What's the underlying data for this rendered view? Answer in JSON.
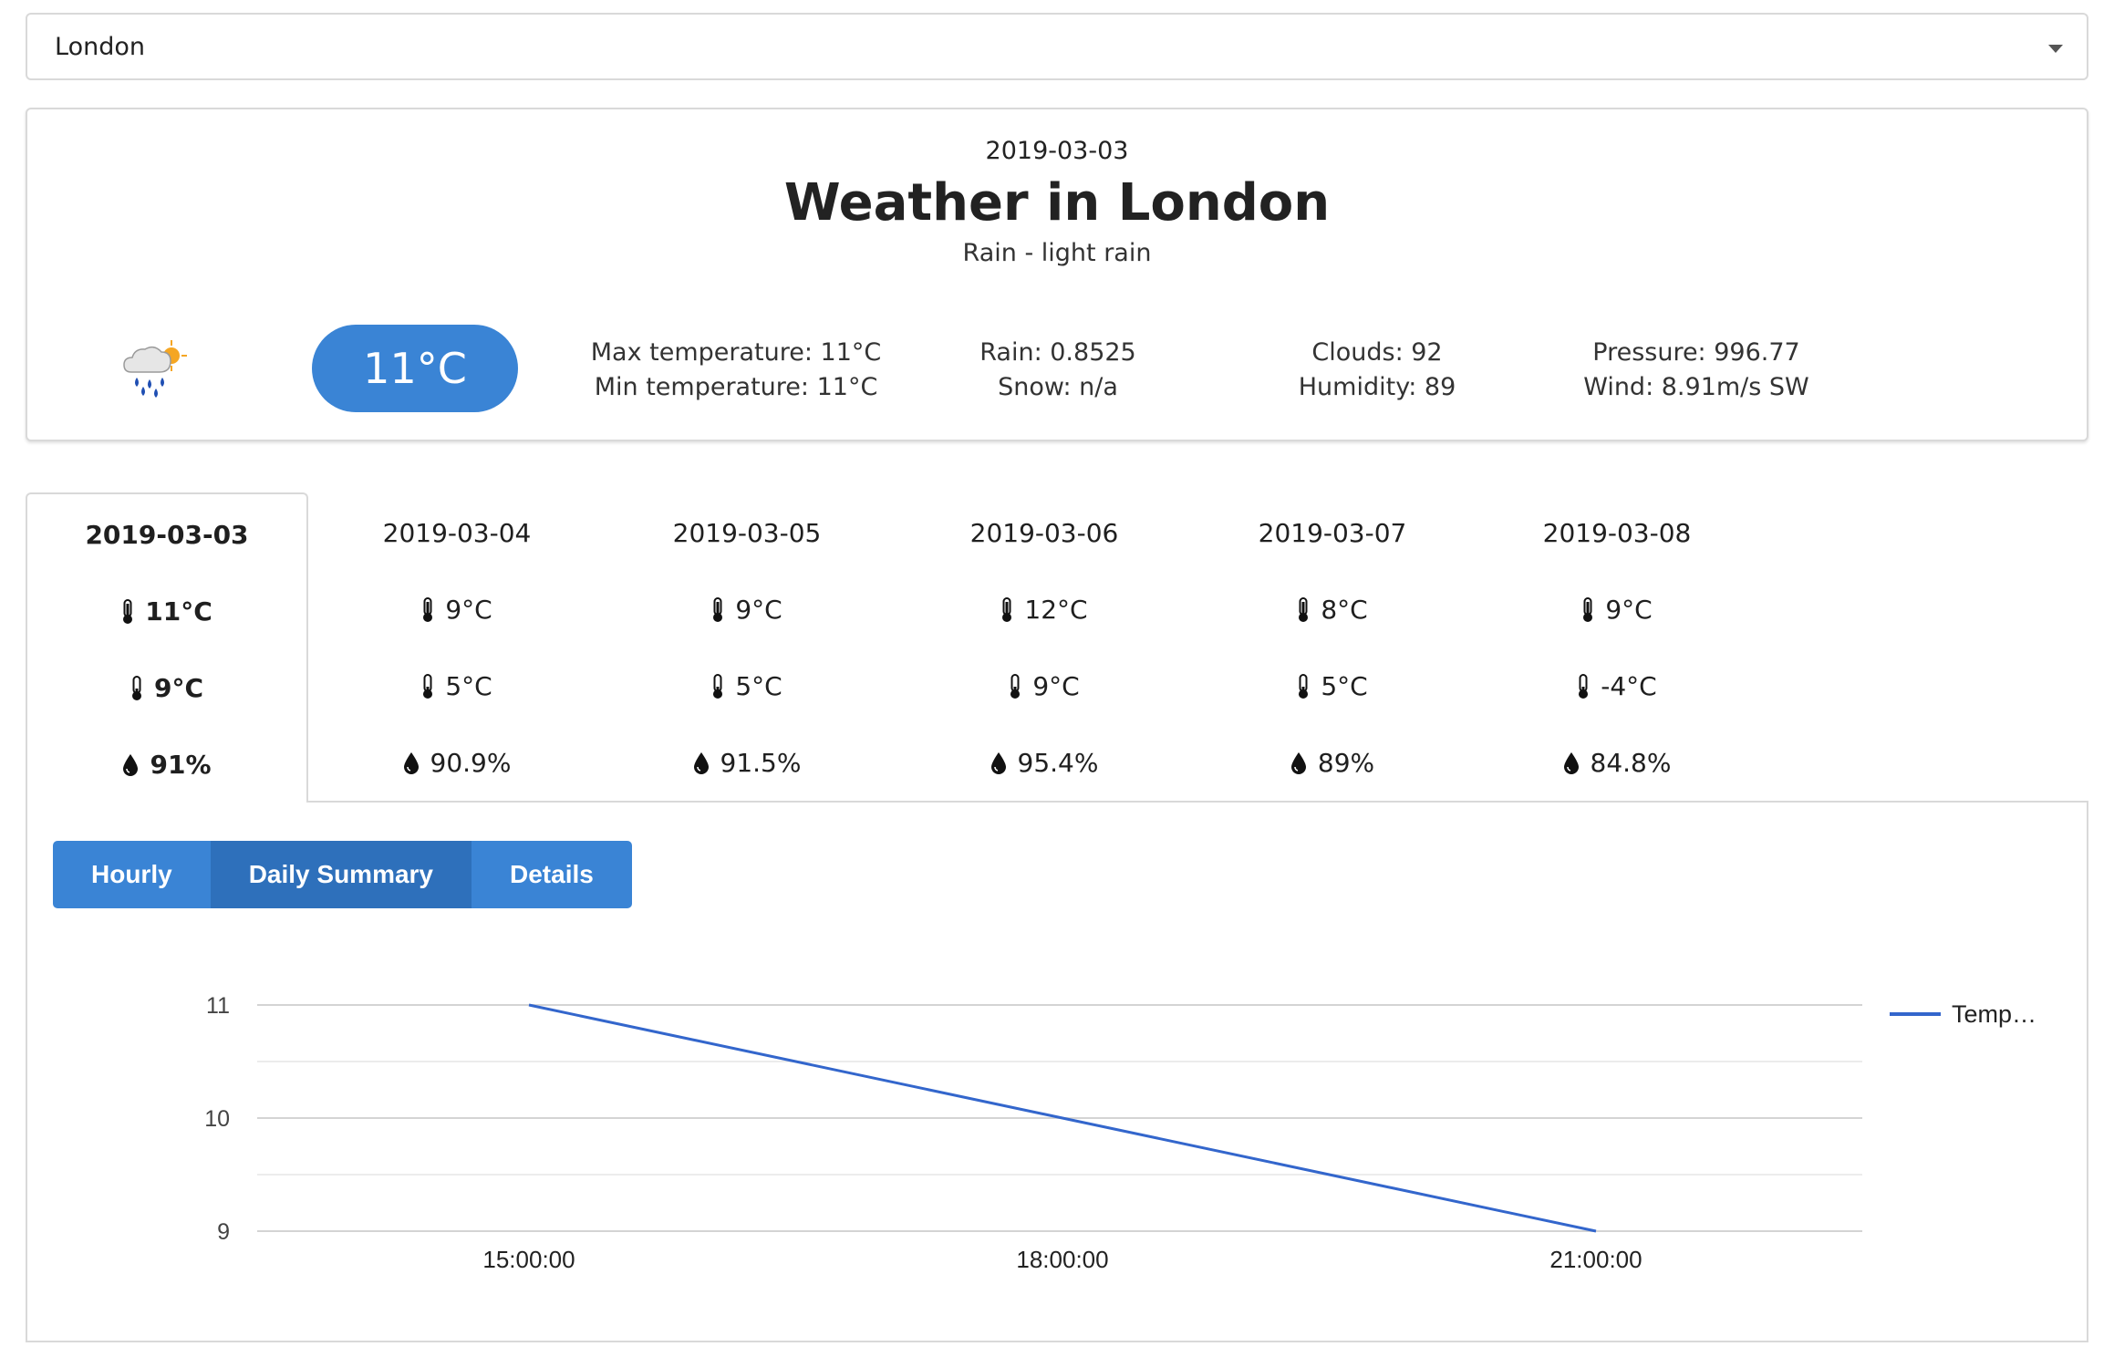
{
  "city_select": {
    "value": "London"
  },
  "summary": {
    "date": "2019-03-03",
    "title": "Weather in London",
    "description": "Rain - light rain",
    "temperature": "11°C",
    "max_temp": "Max temperature: 11°C",
    "min_temp": "Min temperature: 11°C",
    "rain": "Rain: 0.8525",
    "snow": "Snow: n/a",
    "clouds": "Clouds: 92",
    "humidity": "Humidity: 89",
    "pressure": "Pressure: 996.77",
    "wind": "Wind: 8.91m/s SW",
    "icon": "rain-cloud-sun-icon"
  },
  "days": [
    {
      "date": "2019-03-03",
      "max": "11°C",
      "min": "9°C",
      "humidity": "91%"
    },
    {
      "date": "2019-03-04",
      "max": "9°C",
      "min": "5°C",
      "humidity": "90.9%"
    },
    {
      "date": "2019-03-05",
      "max": "9°C",
      "min": "5°C",
      "humidity": "91.5%"
    },
    {
      "date": "2019-03-06",
      "max": "12°C",
      "min": "9°C",
      "humidity": "95.4%"
    },
    {
      "date": "2019-03-07",
      "max": "8°C",
      "min": "5°C",
      "humidity": "89%"
    },
    {
      "date": "2019-03-08",
      "max": "9°C",
      "min": "-4°C",
      "humidity": "84.8%"
    }
  ],
  "view_buttons": {
    "hourly": "Hourly",
    "daily": "Daily Summary",
    "details": "Details"
  },
  "chart_data": {
    "type": "line",
    "x": [
      "15:00:00",
      "18:00:00",
      "21:00:00"
    ],
    "series": [
      {
        "name": "Temp…",
        "values": [
          11,
          10,
          9
        ],
        "color": "#3366cc"
      }
    ],
    "yticks": [
      9,
      10,
      11
    ],
    "ylim": [
      9,
      11
    ],
    "grid": true,
    "legend": "right"
  },
  "colors": {
    "accent": "#3a84d5",
    "accent_active": "#2e70bb",
    "line": "#3366cc"
  }
}
